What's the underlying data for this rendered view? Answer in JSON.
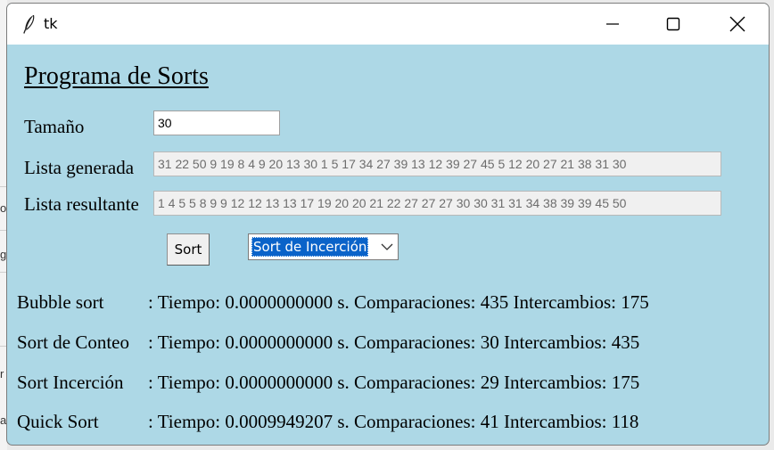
{
  "window": {
    "title": "tk"
  },
  "heading": "Programa de Sorts",
  "form": {
    "size_label": "Tamaño",
    "size_value": "30",
    "generated_label": "Lista generada",
    "generated_value": "31 22 50 9 19 8 4 9 20 13 30 1 5 17 34 27 39 13 12 39 27 45 5 12 20 27 21 38 31 30",
    "result_label": "Lista resultante",
    "result_value": "1 4 5 5 8 9 9 12 12 13 13 17 19 20 20 21 22 27 27 27 30 30 31 31 34 38 39 39 45 50",
    "sort_button": "Sort",
    "algorithm_selected": "Sort de Incerción"
  },
  "results": [
    {
      "name": "Bubble sort",
      "stats": ": Tiempo: 0.0000000000 s. Comparaciones: 435 Intercambios: 175"
    },
    {
      "name": "Sort de Conteo",
      "stats": ": Tiempo: 0.0000000000 s. Comparaciones: 30 Intercambios: 435"
    },
    {
      "name": "Sort Incerción",
      "stats": ": Tiempo: 0.0000000000 s. Comparaciones: 29 Intercambios: 175"
    },
    {
      "name": "Quick Sort",
      "stats": ": Tiempo: 0.0009949207 s. Comparaciones: 41 Intercambios: 118"
    }
  ],
  "background_glyphs": [
    "o",
    "g",
    "r",
    "a"
  ],
  "icons": {
    "app": "feather-icon",
    "minimize": "minimize-icon",
    "maximize": "maximize-icon",
    "close": "close-icon",
    "dropdown": "chevron-down-icon"
  },
  "colors": {
    "window_background": "#add8e6",
    "selection": "#0a63c9",
    "titlebar": "#ffffff"
  }
}
